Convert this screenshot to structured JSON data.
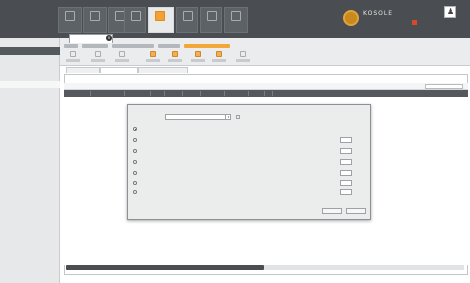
{
  "topbar": {
    "logo": "",
    "nav_tiles": [
      {
        "label": "",
        "icon": "home-icon"
      },
      {
        "label": "",
        "icon": "chart-icon"
      },
      {
        "label": "",
        "icon": "folder-icon"
      },
      {
        "label": "",
        "icon": "book-icon"
      },
      {
        "label": "",
        "icon": "tag-icon",
        "active": true
      },
      {
        "label": "",
        "icon": "search-icon"
      },
      {
        "label": "",
        "icon": "folder-icon"
      },
      {
        "label": "",
        "icon": "gear-icon"
      }
    ],
    "brand_name": "KOSOLE",
    "brand_subtitle": "",
    "brand_link": "",
    "avatar_glyph": "♟",
    "user_name": ""
  },
  "subbar": {
    "doc_tab_label": "",
    "doc_tab_close": "×"
  },
  "sidebar": {
    "head_label": "",
    "items": [
      {
        "label": ""
      },
      {
        "label": ""
      },
      {
        "label": ""
      }
    ]
  },
  "view_tabs": [
    {
      "label": ""
    },
    {
      "label": "",
      "active": true
    },
    {
      "label": ""
    }
  ],
  "main": {
    "title": "",
    "action_label": "",
    "search_label": "",
    "grid_columns": [
      "",
      "",
      "",
      "",
      "",
      "",
      "",
      "",
      "",
      ""
    ]
  },
  "dialog": {
    "title": "",
    "select_label": "",
    "select_value": "",
    "select_arrow": "▾",
    "option_group_label": "",
    "rows": [
      {
        "label": "",
        "mid": "",
        "value": "",
        "field": "",
        "unit": ""
      },
      {
        "label": "",
        "mid": "",
        "value": "",
        "field": "",
        "unit": ""
      },
      {
        "label": "",
        "mid": "",
        "value": "",
        "field": "",
        "unit": ""
      },
      {
        "label": "",
        "mid": "",
        "value": "",
        "field": "",
        "unit": ""
      },
      {
        "label": "",
        "mid": "",
        "value": "",
        "field": "",
        "unit": ""
      },
      {
        "label": "",
        "mid": "",
        "value": "",
        "field": "",
        "unit": ""
      }
    ],
    "link_label": "",
    "buttons": {
      "ok": "",
      "cancel": ""
    }
  },
  "colors": {
    "topbar": "#4a4e52",
    "accent": "#f3a738",
    "grid_header": "#55595d",
    "sidebar_head": "#54595e"
  }
}
